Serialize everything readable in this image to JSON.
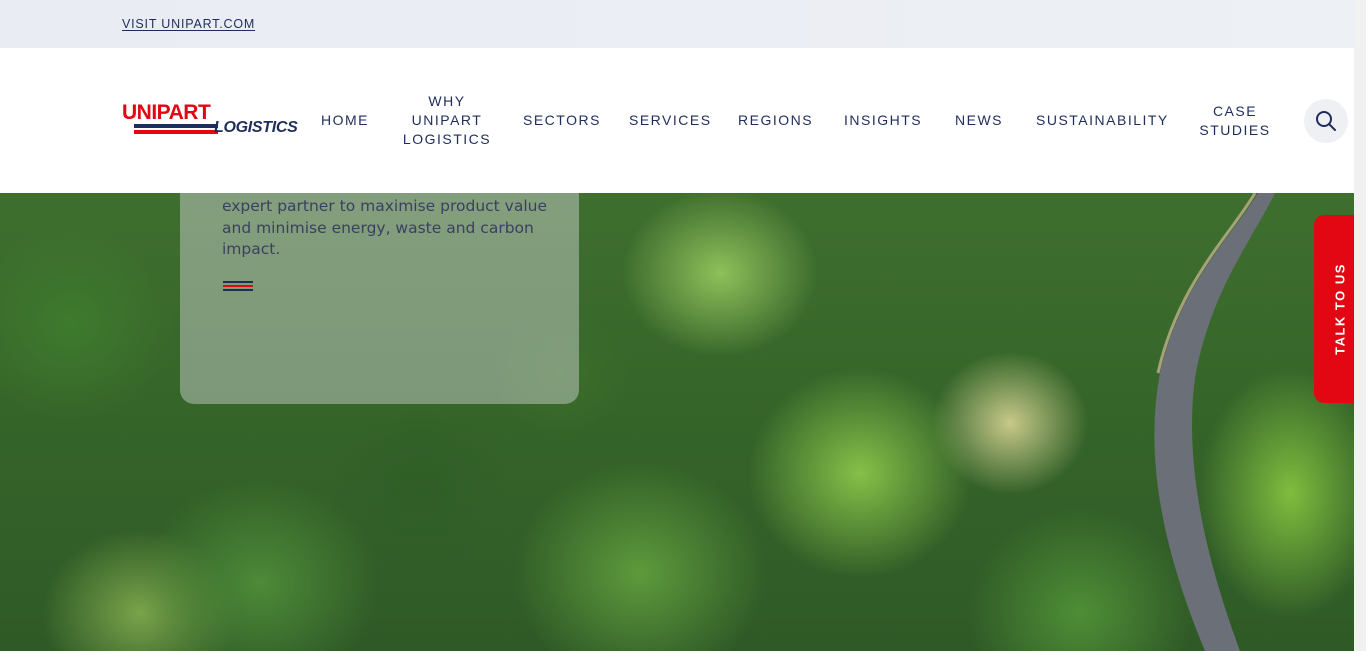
{
  "topbar": {
    "link": "VISIT UNIPART.COM"
  },
  "logo": {
    "line1": "UNIPART",
    "line2": "LOGISTICS"
  },
  "nav": {
    "home": "HOME",
    "why_1": "WHY",
    "why_2": "UNIPART",
    "why_3": "LOGISTICS",
    "sectors": "SECTORS",
    "services": "SERVICES",
    "regions": "REGIONS",
    "insights": "INSIGHTS",
    "news": "NEWS",
    "sustainability": "SUSTAINABILITY",
    "case_1": "CASE",
    "case_2": "STUDIES"
  },
  "hero": {
    "card_text": "expert partner to maximise product value and minimise energy, waste and carbon impact."
  },
  "talk": {
    "label": "TALK TO US"
  },
  "colors": {
    "navy": "#1f2d5c",
    "red": "#e30613"
  },
  "icons": {
    "search": "search-icon"
  }
}
